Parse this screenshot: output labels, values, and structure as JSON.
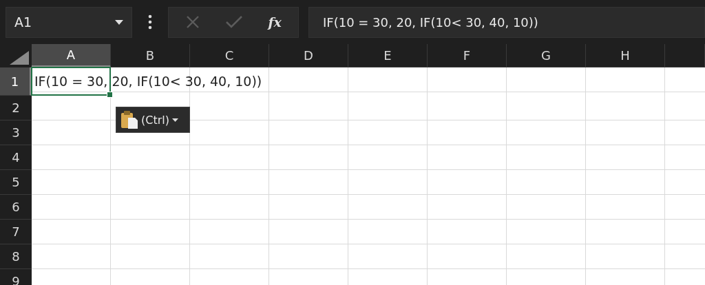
{
  "name_box": {
    "value": "A1"
  },
  "formula_buttons": [
    {
      "kind": "cancel",
      "disabled": true
    },
    {
      "kind": "enter",
      "disabled": true
    },
    {
      "kind": "function",
      "label": "fx",
      "disabled": false
    }
  ],
  "formula_bar": {
    "value": "IF(10 = 30, 20, IF(10< 30, 40, 10))"
  },
  "columns": [
    {
      "label": "A",
      "selected": true
    },
    {
      "label": "B",
      "selected": false
    },
    {
      "label": "C",
      "selected": false
    },
    {
      "label": "D",
      "selected": false
    },
    {
      "label": "E",
      "selected": false
    },
    {
      "label": "F",
      "selected": false
    },
    {
      "label": "G",
      "selected": false
    },
    {
      "label": "H",
      "selected": false
    }
  ],
  "rows": [
    {
      "label": "1",
      "selected": true,
      "cells": [
        "IF(10 = 30, 20, IF(10< 30, 40, 10))"
      ]
    },
    {
      "label": "2",
      "selected": false
    },
    {
      "label": "3",
      "selected": false
    },
    {
      "label": "4",
      "selected": false
    },
    {
      "label": "5",
      "selected": false
    },
    {
      "label": "6",
      "selected": false
    },
    {
      "label": "7",
      "selected": false
    },
    {
      "label": "8",
      "selected": false
    },
    {
      "label": "9",
      "selected": false
    }
  ],
  "paste_options": {
    "label": "(Ctrl)"
  }
}
